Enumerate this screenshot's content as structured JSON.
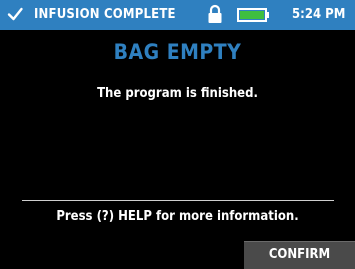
{
  "status_bar": {
    "color": "#2f80c0",
    "check_icon": "checkmark-icon",
    "title": "INFUSION COMPLETE",
    "lock_icon": "lock-icon",
    "battery_icon": "battery-icon",
    "battery_level_color": "#3fbf3f",
    "time": "5:24 PM"
  },
  "main": {
    "title": "BAG EMPTY",
    "title_color": "#2f80c0",
    "message": "The program is finished."
  },
  "footer": {
    "help_text": "Press (?) HELP for more information.",
    "confirm_label": "CONFIRM"
  }
}
